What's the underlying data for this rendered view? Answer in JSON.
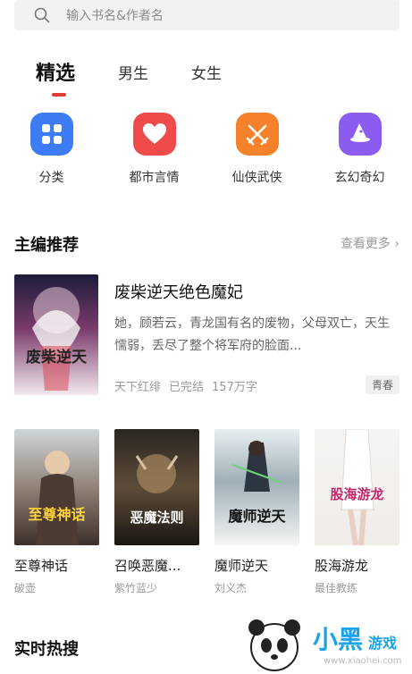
{
  "search": {
    "placeholder": "输入书名&作者名"
  },
  "tabs": [
    {
      "label": "精选",
      "active": true
    },
    {
      "label": "男生",
      "active": false
    },
    {
      "label": "女生",
      "active": false
    }
  ],
  "categories": [
    {
      "label": "分类",
      "icon": "grid-icon",
      "color": "#3d7cf4"
    },
    {
      "label": "都市言情",
      "icon": "heart-icon",
      "color": "#f04b4b"
    },
    {
      "label": "仙侠武侠",
      "icon": "crossed-swords-icon",
      "color": "#f5822a"
    },
    {
      "label": "玄幻奇幻",
      "icon": "wizard-hat-icon",
      "color": "#8b5cf0"
    }
  ],
  "editor_picks": {
    "title": "主编推荐",
    "more": "查看更多 ›",
    "featured": {
      "title": "废柴逆天绝色魔妃",
      "description": "她，顾若云，青龙国有名的废物，父母双亡，天生懦弱，丢尽了整个将军府的脸面...",
      "author": "天下红绯",
      "status": "已完结",
      "words": "157万字",
      "tag": "青春",
      "cover_text": "废柴逆天"
    },
    "books": [
      {
        "title": "至尊神话",
        "author": "破壶",
        "cover_text": "至尊神话"
      },
      {
        "title": "召唤恶魔...",
        "author": "紫竹蓝少",
        "cover_text": "恶魔法则"
      },
      {
        "title": "魔师逆天",
        "author": "刘义杰",
        "cover_text": "魔师逆天"
      },
      {
        "title": "股海游龙",
        "author": "最佳教练",
        "cover_text": "股海游龙"
      }
    ]
  },
  "hot_search": {
    "title": "实时热搜"
  },
  "watermark": {
    "text": "小黑",
    "text2": "游戏",
    "url": "www.xiaohei.com"
  }
}
